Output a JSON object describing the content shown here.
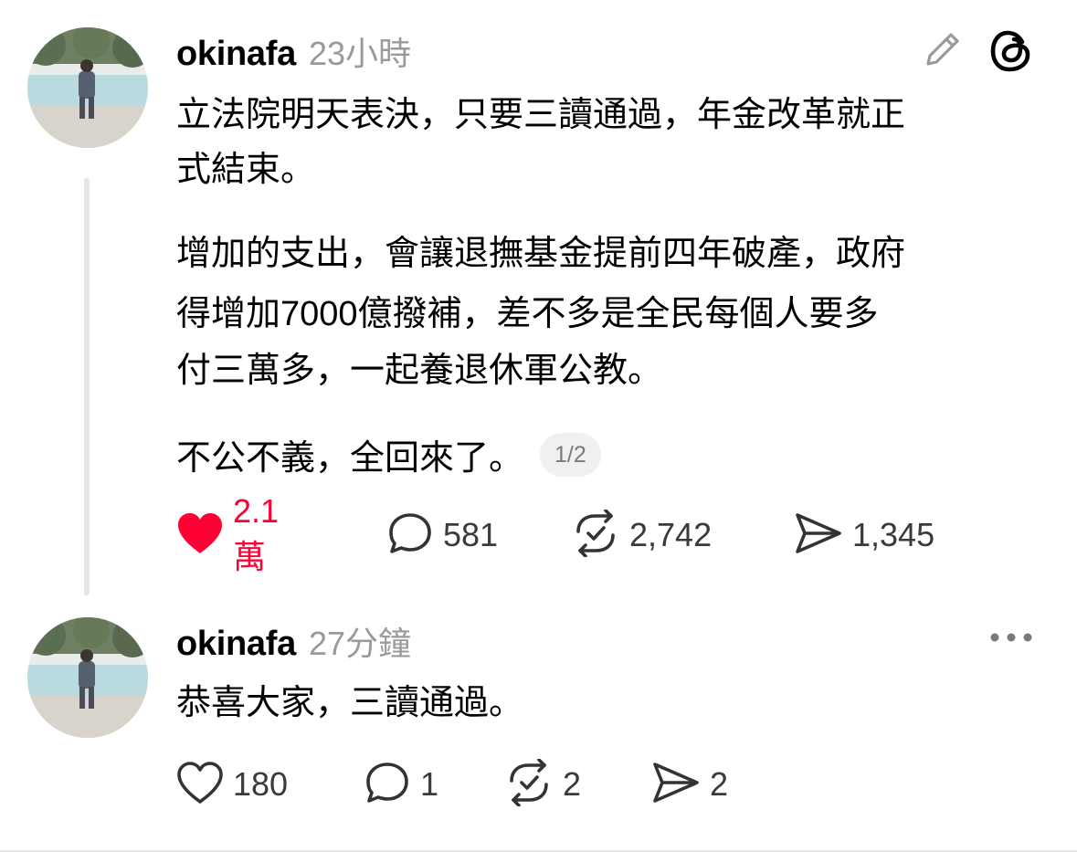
{
  "colors": {
    "like_active": "#ff0034",
    "muted_text": "#9a9a9a",
    "icon_stroke": "#333333"
  },
  "post1": {
    "username": "okinafa",
    "time": "23小時",
    "paragraph1_line1": "立法院明天表決，只要三讀通過，年金改革就正",
    "paragraph1_line2": "式結束。",
    "paragraph2_line1": "增加的支出，會讓退撫基金提前四年破產，政府",
    "paragraph2_line2": "得增加7000億撥補，差不多是全民每個人要多",
    "paragraph2_line3": "付三萬多，一起養退休軍公教。",
    "paragraph3": "不公不義，全回來了。",
    "page_indicator": "1/2",
    "likes": "2.1萬",
    "replies": "581",
    "reposts": "2,742",
    "shares": "1,345",
    "liked": true
  },
  "post2": {
    "username": "okinafa",
    "time": "27分鐘",
    "text": "恭喜大家，三讀通過。",
    "likes": "180",
    "replies": "1",
    "reposts": "2",
    "shares": "2",
    "liked": false
  }
}
